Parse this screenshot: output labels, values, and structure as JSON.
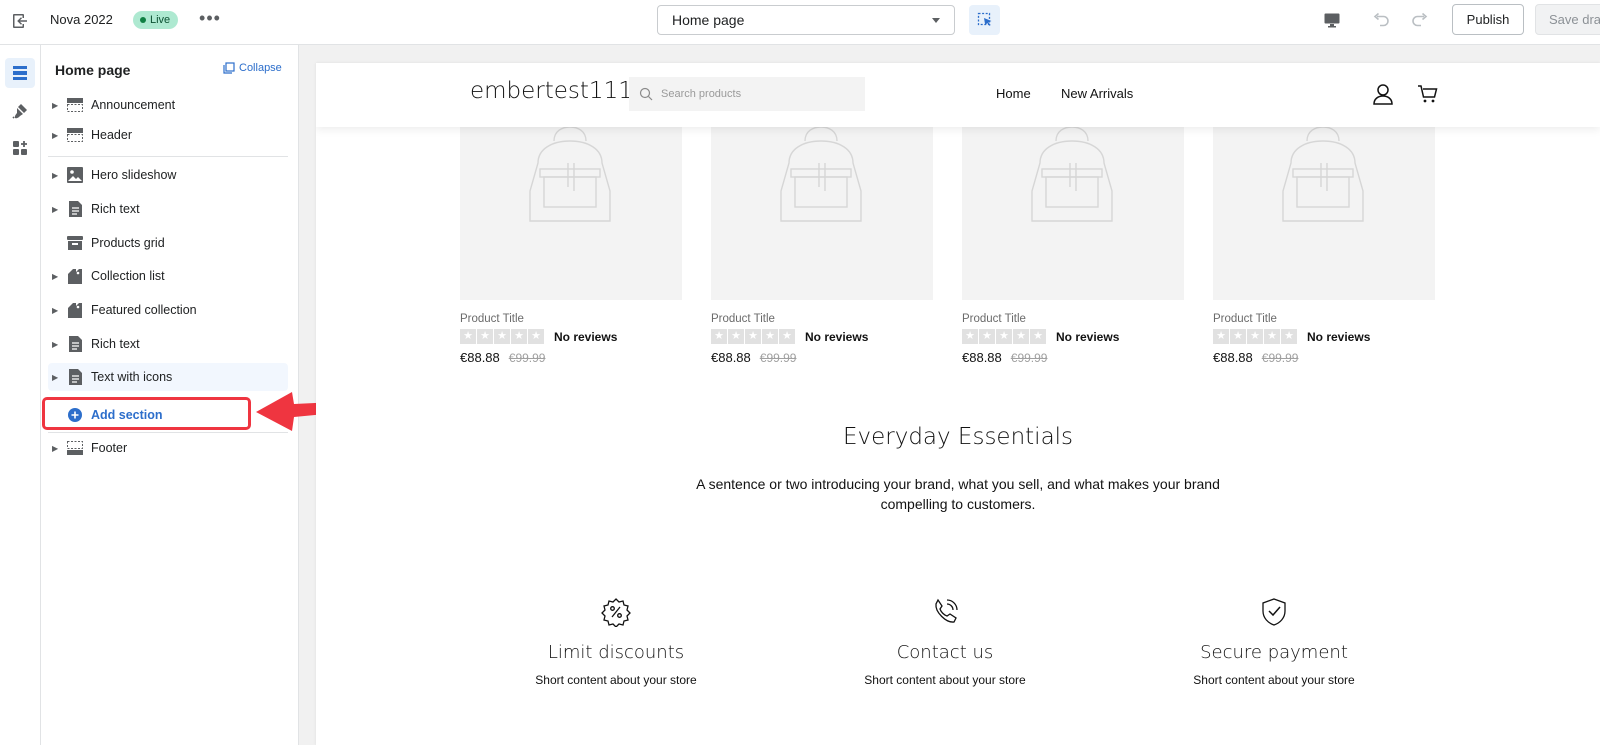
{
  "topbar": {
    "theme_name": "Nova 2022",
    "status_badge": "Live",
    "page_selector": "Home page",
    "publish_label": "Publish",
    "save_label": "Save draft"
  },
  "sidebar": {
    "title": "Home page",
    "collapse_label": "Collapse",
    "sections": [
      {
        "label": "Announcement",
        "icon": "layout-header-icon"
      },
      {
        "label": "Header",
        "icon": "layout-header-icon"
      },
      {
        "label": "Hero slideshow",
        "icon": "image-icon"
      },
      {
        "label": "Rich text",
        "icon": "text-block-icon"
      },
      {
        "label": "Products grid",
        "icon": "products-icon"
      },
      {
        "label": "Collection list",
        "icon": "collection-icon"
      },
      {
        "label": "Featured collection",
        "icon": "collection-icon"
      },
      {
        "label": "Rich text",
        "icon": "text-block-icon"
      },
      {
        "label": "Text with icons",
        "icon": "text-block-icon"
      }
    ],
    "add_section_label": "Add section",
    "footer_label": "Footer"
  },
  "store": {
    "name": "embertest111",
    "search_placeholder": "Search products",
    "nav": [
      "Home",
      "New Arrivals"
    ]
  },
  "products": [
    {
      "title": "Product Title",
      "rating": 0,
      "reviews": "No reviews",
      "price": "€88.88",
      "compare_price": "€99.99"
    },
    {
      "title": "Product Title",
      "rating": 0,
      "reviews": "No reviews",
      "price": "€88.88",
      "compare_price": "€99.99"
    },
    {
      "title": "Product Title",
      "rating": 0,
      "reviews": "No reviews",
      "price": "€88.88",
      "compare_price": "€99.99"
    },
    {
      "title": "Product Title",
      "rating": 0,
      "reviews": "No reviews",
      "price": "€88.88",
      "compare_price": "€99.99"
    }
  ],
  "rich_text": {
    "heading": "Everyday Essentials",
    "body": "A sentence or two introducing your brand, what you sell, and what makes your brand compelling to customers."
  },
  "features": [
    {
      "title": "Limit discounts",
      "text": "Short content about your store",
      "icon": "discount-icon"
    },
    {
      "title": "Contact us",
      "text": "Short content about your store",
      "icon": "phone-icon"
    },
    {
      "title": "Secure payment",
      "text": "Short content about your store",
      "icon": "shield-check-icon"
    }
  ],
  "colors": {
    "accent": "#2c6ecb",
    "highlight": "#ef3540",
    "live_badge": "#aee9d1"
  }
}
